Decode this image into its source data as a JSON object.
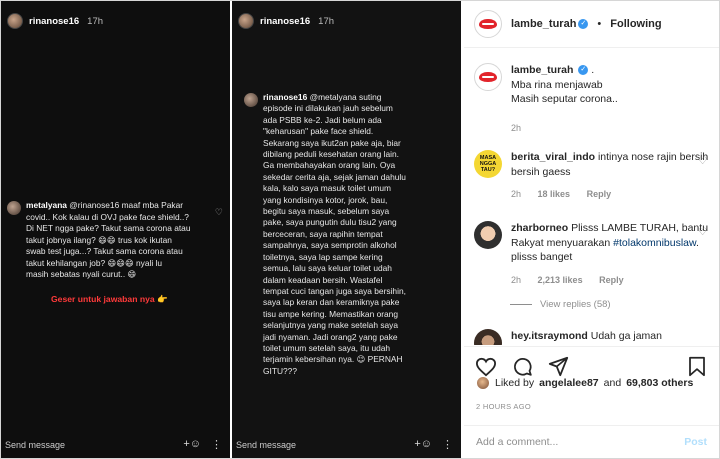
{
  "story_left": {
    "username": "rinanose16",
    "time": "17h",
    "comment": {
      "author": "metalyana",
      "lines": [
        "@rinanose16 maaf mba Pakar",
        "covid.. Kok kalau di OVJ pake face shield..?",
        "Di NET ngga pake? Takut sama corona atau",
        "takut jobnya ilang? 😄😄 trus kok ikutan",
        "swab test juga...? Takut sama corona atau",
        "takut kehilangan job? 😄😄😄 nyali lu",
        "masih sebatas nyali curut.. 😄"
      ]
    },
    "swipe_text": "Geser untuk jawaban nya 👉",
    "send_placeholder": "Send message"
  },
  "story_right": {
    "username": "rinanose16",
    "time": "17h",
    "reply": {
      "author": "rinanose16",
      "lines": [
        "@metalyana suting",
        "episode ini dilakukan jauh sebelum",
        "ada PSBB ke-2. Jadi belum ada",
        "\"keharusan\" pake face shield.",
        "Sekarang saya ikut2an pake aja, biar",
        "dibilang peduli kesehatan orang lain.",
        "Ga membahayakan orang lain. Oya",
        "sekedar cerita aja, sejak jaman dahulu",
        "kala, kalo saya masuk toilet umum",
        "yang kondisinya kotor, jorok, bau,",
        "begitu saya masuk, sebelum saya",
        "pake, saya pungutin dulu tisu2 yang",
        "berceceran, saya rapihin tempat",
        "sampahnya, saya semprotin alkohol",
        "toiletnya, saya lap sampe kering",
        "semua, lalu saya keluar toilet udah",
        "dalam keadaan bersih. Wastafel",
        "tempat cuci tangan juga saya bersihin,",
        "saya lap keran dan keramiknya pake",
        "tisu ampe kering. Memastikan orang",
        "selanjutnya yang make setelah saya",
        "jadi nyaman. Jadi orang2 yang pake",
        "toilet umum setelah saya, itu udah",
        "terjamin kebersihan nya. 😉 PERNAH",
        "GITU???"
      ]
    },
    "send_placeholder": "Send message"
  },
  "post": {
    "account": "lambe_turah",
    "follow_label": "Following",
    "caption": {
      "author": "lambe_turah",
      "lines": [
        "Mba rina menjawab",
        "Masih seputar corona.."
      ],
      "time": "2h"
    },
    "comments": [
      {
        "author": "berita_viral_indo",
        "text": "intinya nose rajin bersih bersih gaess",
        "avatar_text": "MASA NGGA TAU?",
        "time": "2h",
        "likes": "18 likes",
        "reply": "Reply"
      },
      {
        "author": "zharborneo",
        "text": "Plisss LAMBE TURAH, bantu Rakyat menyuarakan",
        "hashtag": "#tolakomnibuslaw",
        "text_after": ". plisss banget",
        "time": "2h",
        "likes": "2,213 likes",
        "reply": "Reply"
      },
      {
        "author": "hey.itsraymond",
        "text": "Udah ga jaman"
      }
    ],
    "view_replies": "View replies (58)",
    "likes": {
      "prefix": "Liked by",
      "user": "angelalee87",
      "joiner": "and",
      "count": "69,803 others"
    },
    "timestamp": "2 HOURS AGO",
    "comment_placeholder": "Add a comment...",
    "post_button": "Post"
  },
  "colors": {
    "brand_red": "#e2242b",
    "verified_blue": "#3897f0",
    "swipe_red": "#ff3a3a",
    "hashtag_blue": "#00376b",
    "post_button_disabled": "#b2dffc"
  }
}
